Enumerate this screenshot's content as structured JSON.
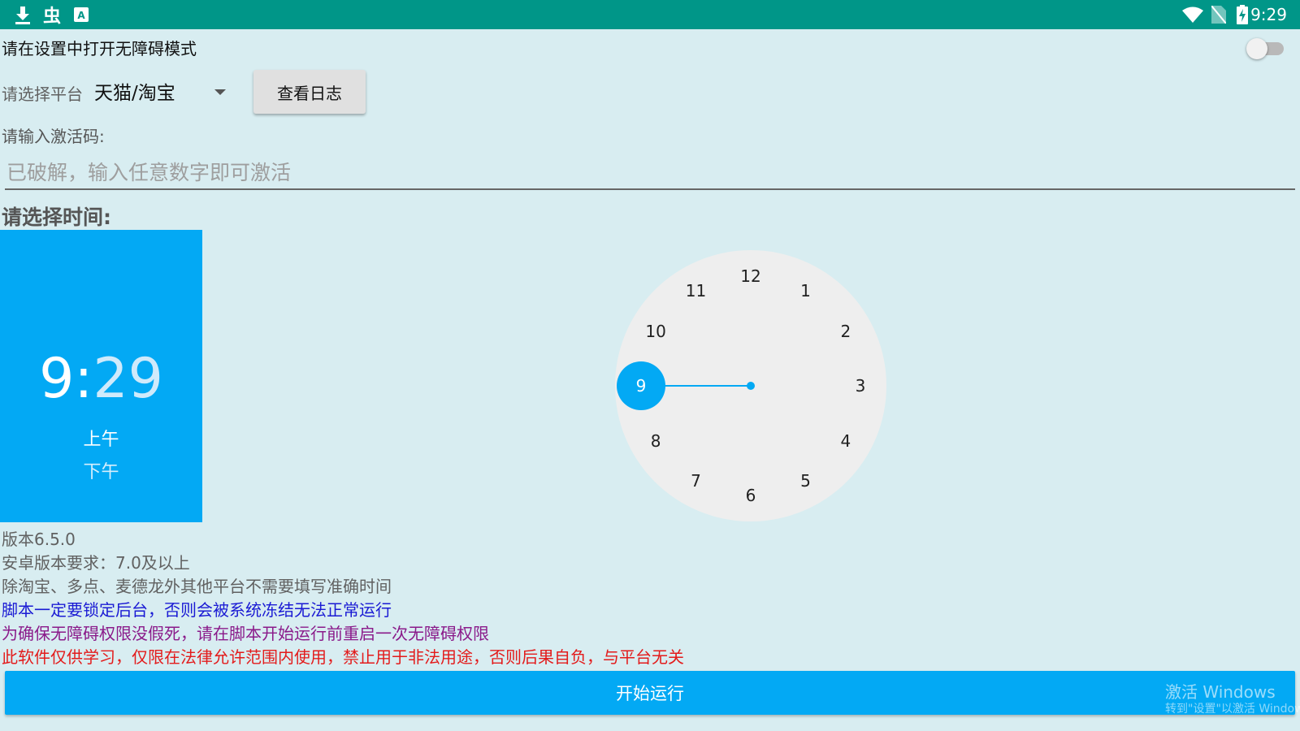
{
  "status_bar": {
    "time": "9:29",
    "left_icons": [
      "download-icon",
      "bug-icon",
      "keyboard-icon"
    ],
    "right_icons": [
      "wifi-icon",
      "no-sim-icon",
      "battery-charging-icon"
    ]
  },
  "accessibility": {
    "text": "请在设置中打开无障碍模式",
    "toggle_on": false
  },
  "platform": {
    "label": "请选择平台",
    "selected": "天猫/淘宝"
  },
  "log_button": "查看日志",
  "activation": {
    "label": "请输入激活码:",
    "placeholder": "已破解，输入任意数字即可激活"
  },
  "time_picker": {
    "label": "请选择时间:",
    "hour": "9",
    "separator": ":",
    "minute": "29",
    "am": "上午",
    "pm": "下午",
    "selected_period": "上午",
    "selected_hour": "9",
    "clock_numbers": [
      "12",
      "1",
      "2",
      "3",
      "4",
      "5",
      "6",
      "7",
      "8",
      "9",
      "10",
      "11"
    ]
  },
  "info": {
    "version": "版本6.5.0",
    "android_req": "安卓版本要求：7.0及以上",
    "note1": "除淘宝、多点、麦德龙外其他平台不需要填写准确时间",
    "note2": "脚本一定要锁定后台，否则会被系统冻结无法正常运行",
    "note3": "为确保无障碍权限没假死，请在脚本开始运行前重启一次无障碍权限",
    "note4": "此软件仅供学习，仅限在法律允许范围内使用，禁止用于非法用途，否则后果自负，与平台无关"
  },
  "start_button": "开始运行",
  "watermark": {
    "title": "激活 Windows",
    "subtitle": "转到\"设置\"以激活 Windows。"
  },
  "colors": {
    "status_bar": "#009688",
    "background": "#d8edf1",
    "accent": "#03a9f4",
    "blue_text": "#1a1ad4",
    "purple_text": "#8a1a8a",
    "red_text": "#e31b1b"
  }
}
